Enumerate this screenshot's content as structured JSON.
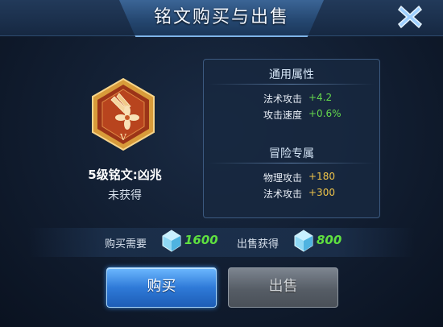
{
  "dialog": {
    "title": "铭文购买与出售",
    "close_icon": "close-x-icon"
  },
  "rune": {
    "name": "5级铭文:凶兆",
    "status": "未获得",
    "level_numeral": "V",
    "icon": "rune-hexagon-icon"
  },
  "attributes": {
    "general": {
      "heading": "通用属性",
      "items": [
        {
          "label": "法术攻击",
          "value": "+4.2"
        },
        {
          "label": "攻击速度",
          "value": "+0.6%"
        }
      ]
    },
    "adventure": {
      "heading": "冒险专属",
      "items": [
        {
          "label": "物理攻击",
          "value": "+180"
        },
        {
          "label": "法术攻击",
          "value": "+300"
        }
      ]
    }
  },
  "price": {
    "buy_label": "购买需要",
    "buy_value": "1600",
    "sell_label": "出售获得",
    "sell_value": "800",
    "currency_icon": "crystal-icon"
  },
  "buttons": {
    "buy": "购买",
    "sell": "出售"
  },
  "colors": {
    "general_value": "#65d94d",
    "adventure_value": "#f2c64a",
    "price_value": "#5fe040",
    "buy_button": "#2f7ad8",
    "sell_button": "#565d66"
  }
}
